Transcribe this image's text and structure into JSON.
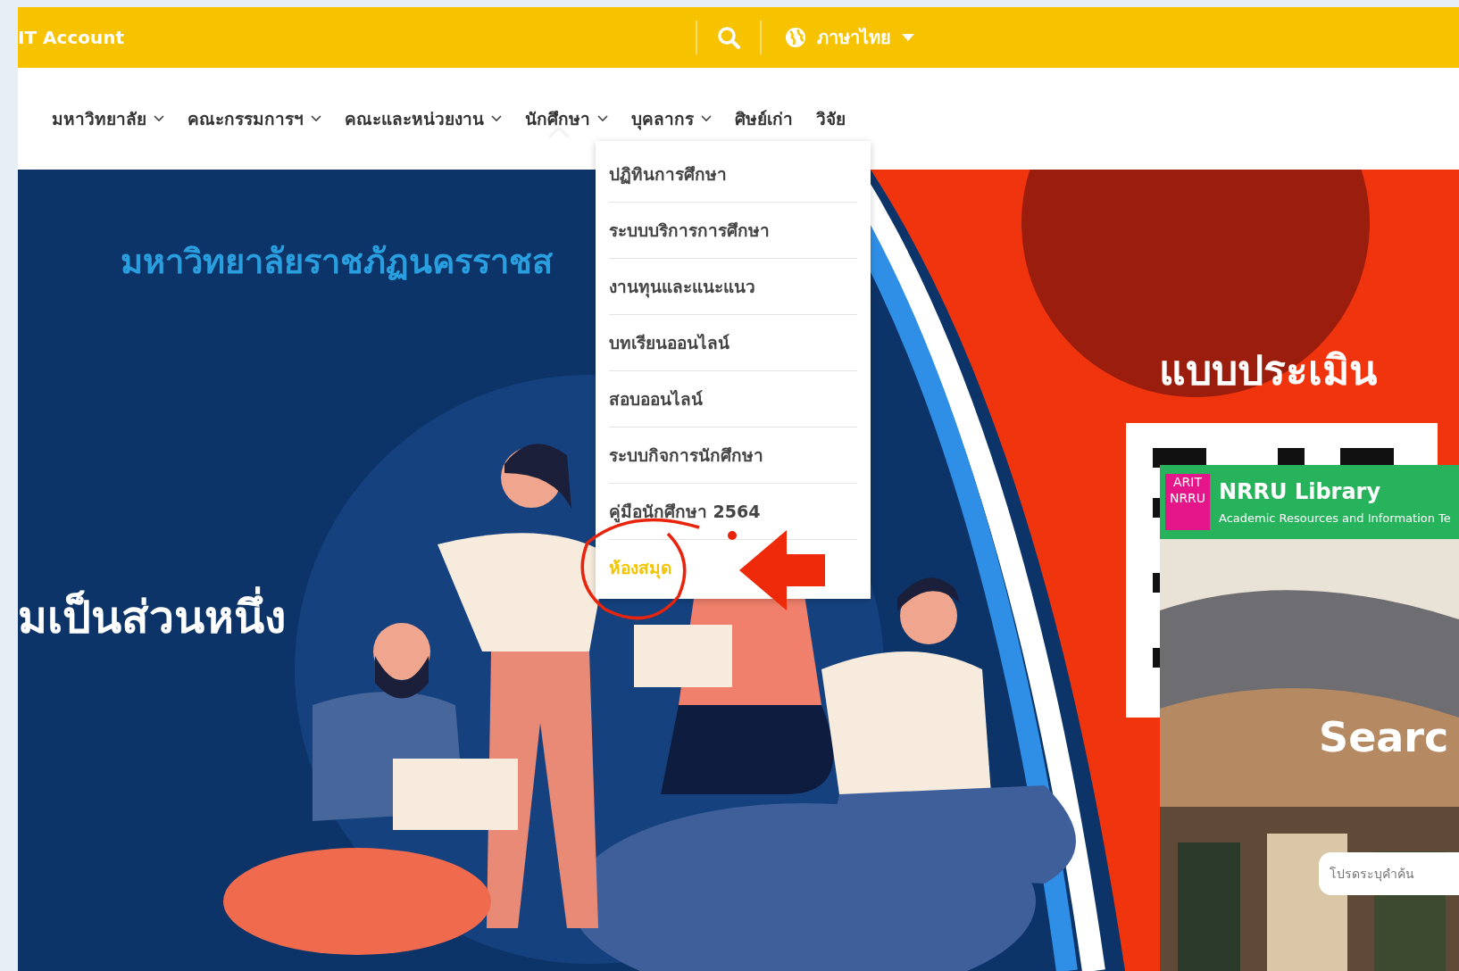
{
  "top_bar": {
    "account_link": "IT Account",
    "language": "ภาษาไทย"
  },
  "nav": {
    "items": [
      {
        "label": "มหาวิทยาลัย",
        "has_dropdown": true,
        "expanded": false
      },
      {
        "label": "คณะกรรมการฯ",
        "has_dropdown": true,
        "expanded": false
      },
      {
        "label": "คณะและหน่วยงาน",
        "has_dropdown": true,
        "expanded": false
      },
      {
        "label": "นักศึกษา",
        "has_dropdown": true,
        "expanded": true
      },
      {
        "label": "บุคลากร",
        "has_dropdown": true,
        "expanded": false
      },
      {
        "label": "ศิษย์เก่า",
        "has_dropdown": false,
        "expanded": false
      },
      {
        "label": "วิจัย",
        "has_dropdown": false,
        "expanded": false
      }
    ]
  },
  "dropdown": {
    "items": [
      {
        "label": "ปฏิทินการศึกษา",
        "selected": false
      },
      {
        "label": "ระบบบริการการศึกษา",
        "selected": false
      },
      {
        "label": "งานทุนและแนะแนว",
        "selected": false
      },
      {
        "label": "บทเรียนออนไลน์",
        "selected": false
      },
      {
        "label": "สอบออนไลน์",
        "selected": false
      },
      {
        "label": "ระบบกิจการนักศึกษา",
        "selected": false
      },
      {
        "label": "คู่มือนักศึกษา 2564",
        "selected": false
      },
      {
        "label": "ห้องสมุด",
        "selected": true
      }
    ]
  },
  "banner": {
    "university_name": "มหาวิทยาลัยราชภัฏนครราชส",
    "slogan": "มเป็นส่วนหนึ่ง",
    "evaluation_title": "แบบประเมิน"
  },
  "library_panel": {
    "logo_text": [
      "ARIT",
      "NRRU"
    ],
    "title": "NRRU Library",
    "subtitle": "Academic Resources and Information Te",
    "heading": "Searc",
    "search": {
      "placeholder": "โปรดระบุคำค้น"
    }
  }
}
